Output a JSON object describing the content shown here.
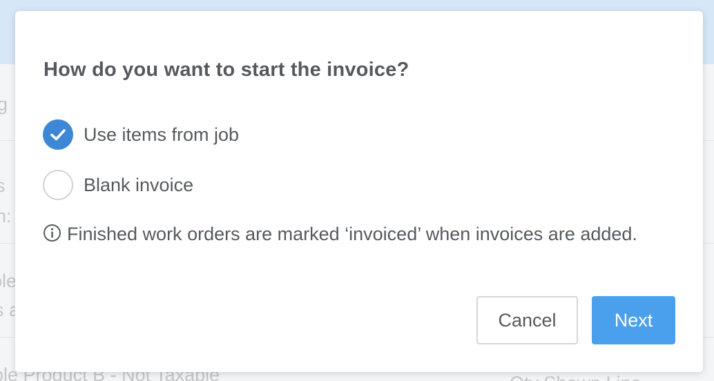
{
  "background": {
    "fragments": [
      "g",
      "s",
      "h:",
      "ple",
      "s a",
      "ple Product B - Not Taxable",
      "Qty Shown Line"
    ]
  },
  "dialog": {
    "title": "How do you want to start the invoice?",
    "options": [
      {
        "label": "Use items from job",
        "checked": true
      },
      {
        "label": "Blank invoice",
        "checked": false
      }
    ],
    "info_text": "Finished work orders are marked ‘invoiced’ when invoices are added.",
    "buttons": {
      "cancel_label": "Cancel",
      "next_label": "Next"
    }
  },
  "colors": {
    "accent": "#3d87d6",
    "primary_button": "#4aa0ec",
    "text": "#55595e"
  },
  "icons": {
    "checked": "checkmark-icon",
    "info": "info-icon"
  }
}
